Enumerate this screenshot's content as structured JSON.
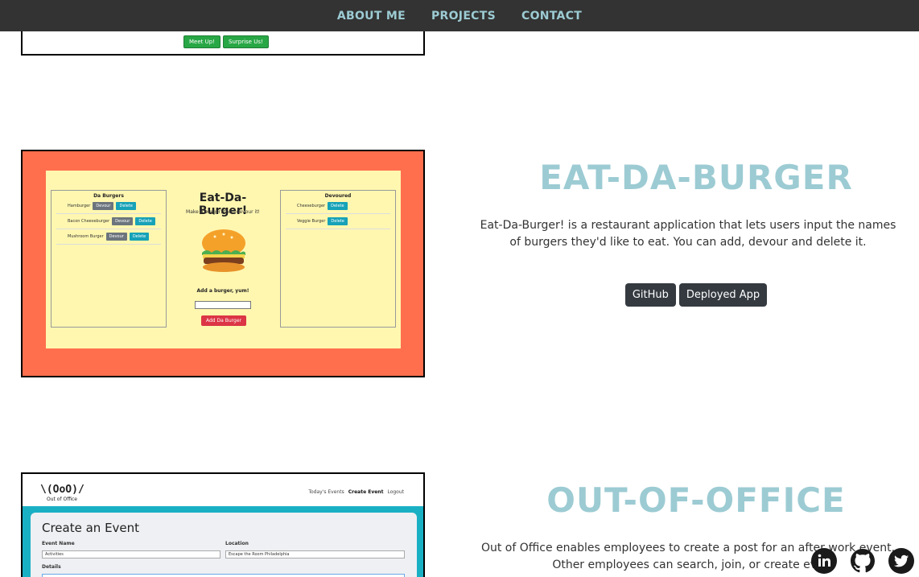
{
  "nav": {
    "about": "ABOUT ME",
    "projects": "PROJECTS",
    "contact": "CONTACT"
  },
  "project_top": {
    "btn1": "Meet Up!",
    "btn2": "Surprise Us!"
  },
  "burger": {
    "title": "EAT-DA-BURGER",
    "description": "Eat-Da-Burger! is a restaurant application that lets users input the names of burgers they'd like to eat. You can add, devour and delete it.",
    "github": "GitHub",
    "deployed": "Deployed App",
    "thumb": {
      "left_head": "Da Burgers",
      "right_head": "Devoured",
      "app_title": "Eat-Da-Burger!",
      "app_sub": "Make a burger, then devour it!",
      "add_label": "Add a burger, yum!",
      "add_button": "Add Da Burger",
      "devour": "Devour",
      "delete": "Delete",
      "left_items": [
        "Hamburger",
        "Bacon Cheeseburger",
        "Mushroom Burger"
      ],
      "right_items": [
        "Cheeseburger",
        "Veggie Burger"
      ]
    }
  },
  "office": {
    "title": "OUT-OF-OFFICE",
    "description": "Out of Office enables employees to create a post for an after work event. Other employees can search, join, or create eve",
    "thumb": {
      "logo": "\\(OoO)/",
      "logo_sub": "Out of Office",
      "nav_today": "Today's Events",
      "nav_create": "Create Event",
      "nav_logout": "Logout",
      "heading": "Create an Event",
      "event_name_label": "Event Name",
      "event_name_value": "Activities",
      "location_label": "Location",
      "location_value": "Escape the Room Philadelphia",
      "details_label": "Details"
    }
  },
  "social": {
    "linkedin": "linkedin-icon",
    "github": "github-icon",
    "twitter": "twitter-icon"
  },
  "colors": {
    "accent": "#9ccbd3",
    "nav_bg": "#333333",
    "burger_bg": "#ff6f4d"
  }
}
